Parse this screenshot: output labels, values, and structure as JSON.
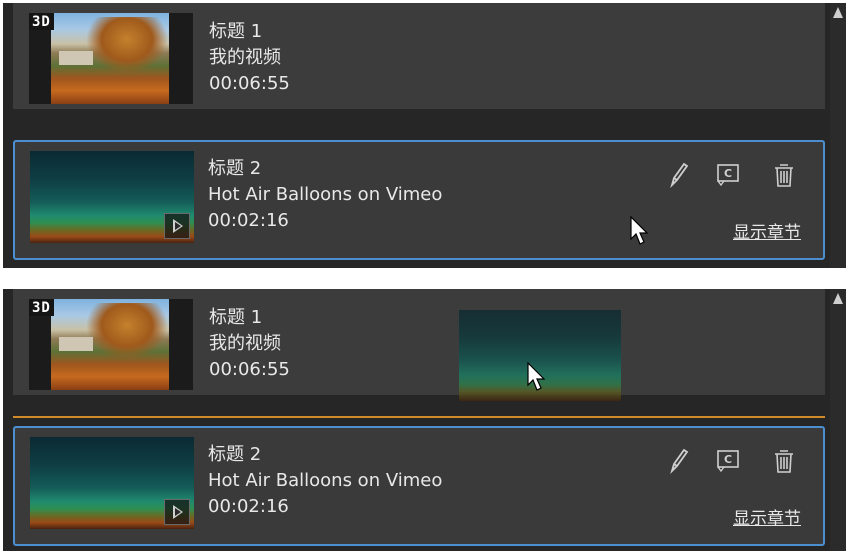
{
  "panels": [
    {
      "items": [
        {
          "title": "标题 1",
          "subtitle": "我的视频",
          "duration": "00:06:55",
          "badge": "3D"
        },
        {
          "title": "标题 2",
          "subtitle": "Hot Air Balloons on Vimeo",
          "duration": "00:02:16",
          "show_chapters": "显示章节"
        }
      ]
    },
    {
      "items": [
        {
          "title": "标题 1",
          "subtitle": "我的视频",
          "duration": "00:06:55",
          "badge": "3D"
        },
        {
          "title": "标题 2",
          "subtitle": "Hot Air Balloons on Vimeo",
          "duration": "00:02:16",
          "show_chapters": "显示章节"
        }
      ]
    }
  ],
  "colors": {
    "selection_border": "#4b8fd1",
    "drop_indicator": "#d08a2a",
    "panel_bg": "#262626",
    "item_bg": "#3c3c3c"
  },
  "icons": [
    "scroll-up-icon",
    "edit-pencil-icon",
    "caption-icon",
    "trash-icon",
    "play-icon",
    "mouse-cursor-icon"
  ]
}
